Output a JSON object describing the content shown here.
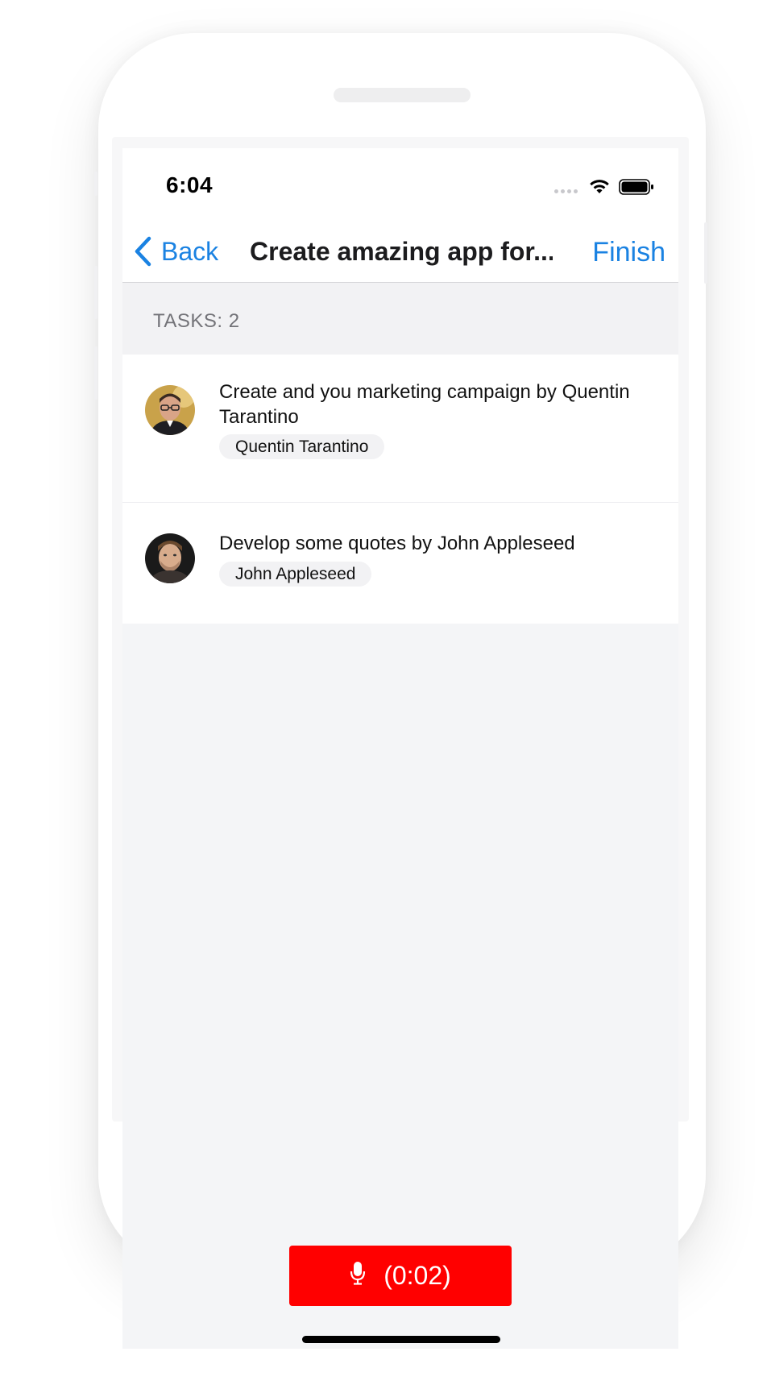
{
  "status_bar": {
    "time": "6:04"
  },
  "navbar": {
    "back_label": "Back",
    "title": "Create amazing app for...",
    "finish_label": "Finish"
  },
  "section": {
    "header": "TASKS: 2"
  },
  "tasks": [
    {
      "text": "Create and you marketing campaign by Quentin Tarantino",
      "assignee": "Quentin Tarantino",
      "avatar": "portrait-man-glasses"
    },
    {
      "text": "Develop some quotes by John Appleseed",
      "assignee": "John Appleseed",
      "avatar": "portrait-man-stubble"
    }
  ],
  "recorder": {
    "icon": "microphone-icon",
    "label": "(0:02)"
  },
  "colors": {
    "accent": "#1a82e2",
    "record": "#ff0000",
    "background": "#f4f5f7"
  }
}
